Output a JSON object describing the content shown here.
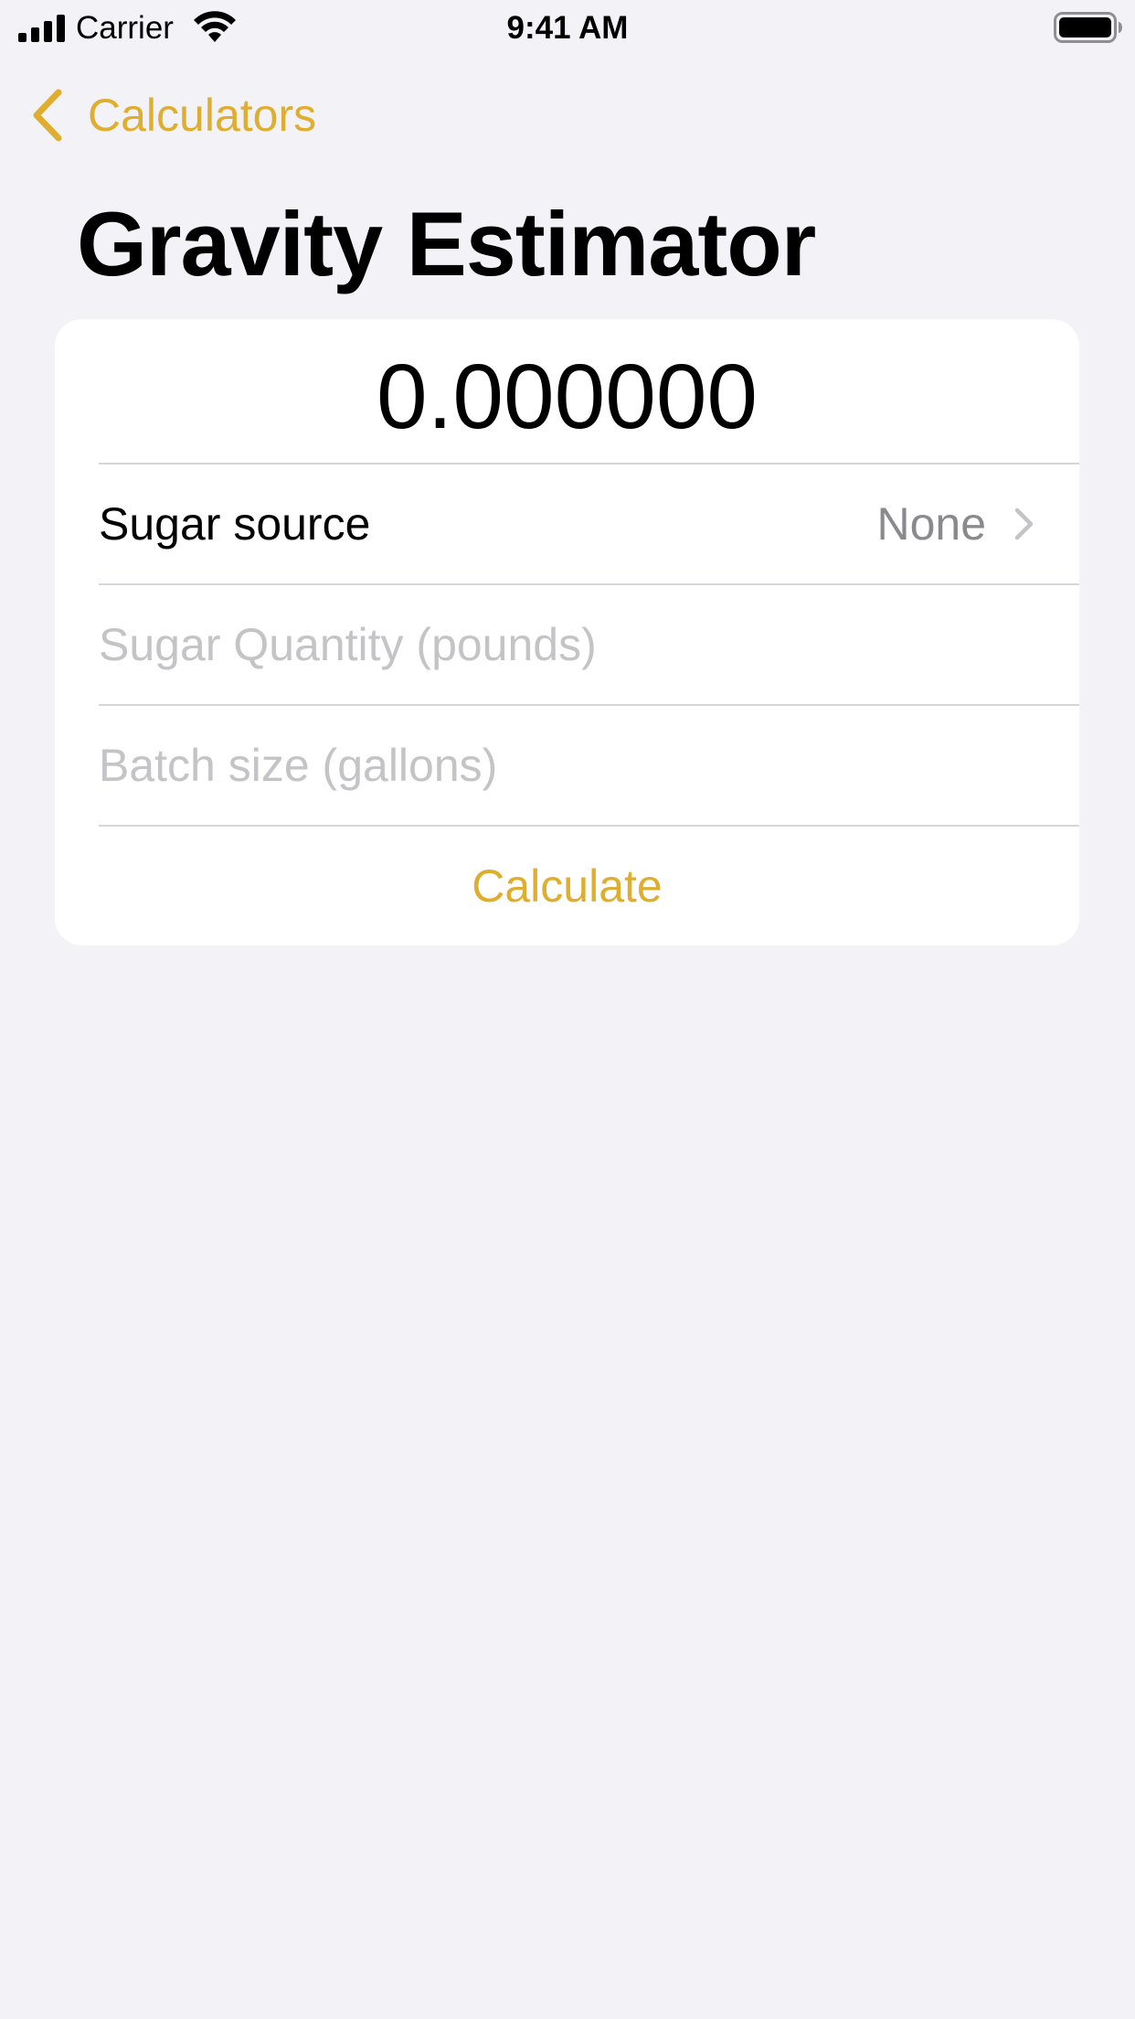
{
  "status_bar": {
    "carrier": "Carrier",
    "time": "9:41 AM"
  },
  "nav": {
    "back_label": "Calculators"
  },
  "page": {
    "title": "Gravity Estimator"
  },
  "form": {
    "result": "0.000000",
    "sugar_source_label": "Sugar source",
    "sugar_source_value": "None",
    "sugar_quantity_placeholder": "Sugar Quantity (pounds)",
    "sugar_quantity_value": "",
    "batch_size_placeholder": "Batch size (gallons)",
    "batch_size_value": "",
    "calculate_label": "Calculate"
  },
  "colors": {
    "accent": "#E0AE2E",
    "background": "#F2F2F7",
    "card": "#FFFFFF",
    "secondary_text": "#8A8A8E",
    "placeholder_text": "#C4C4C7",
    "separator": "#D6D6DA"
  }
}
